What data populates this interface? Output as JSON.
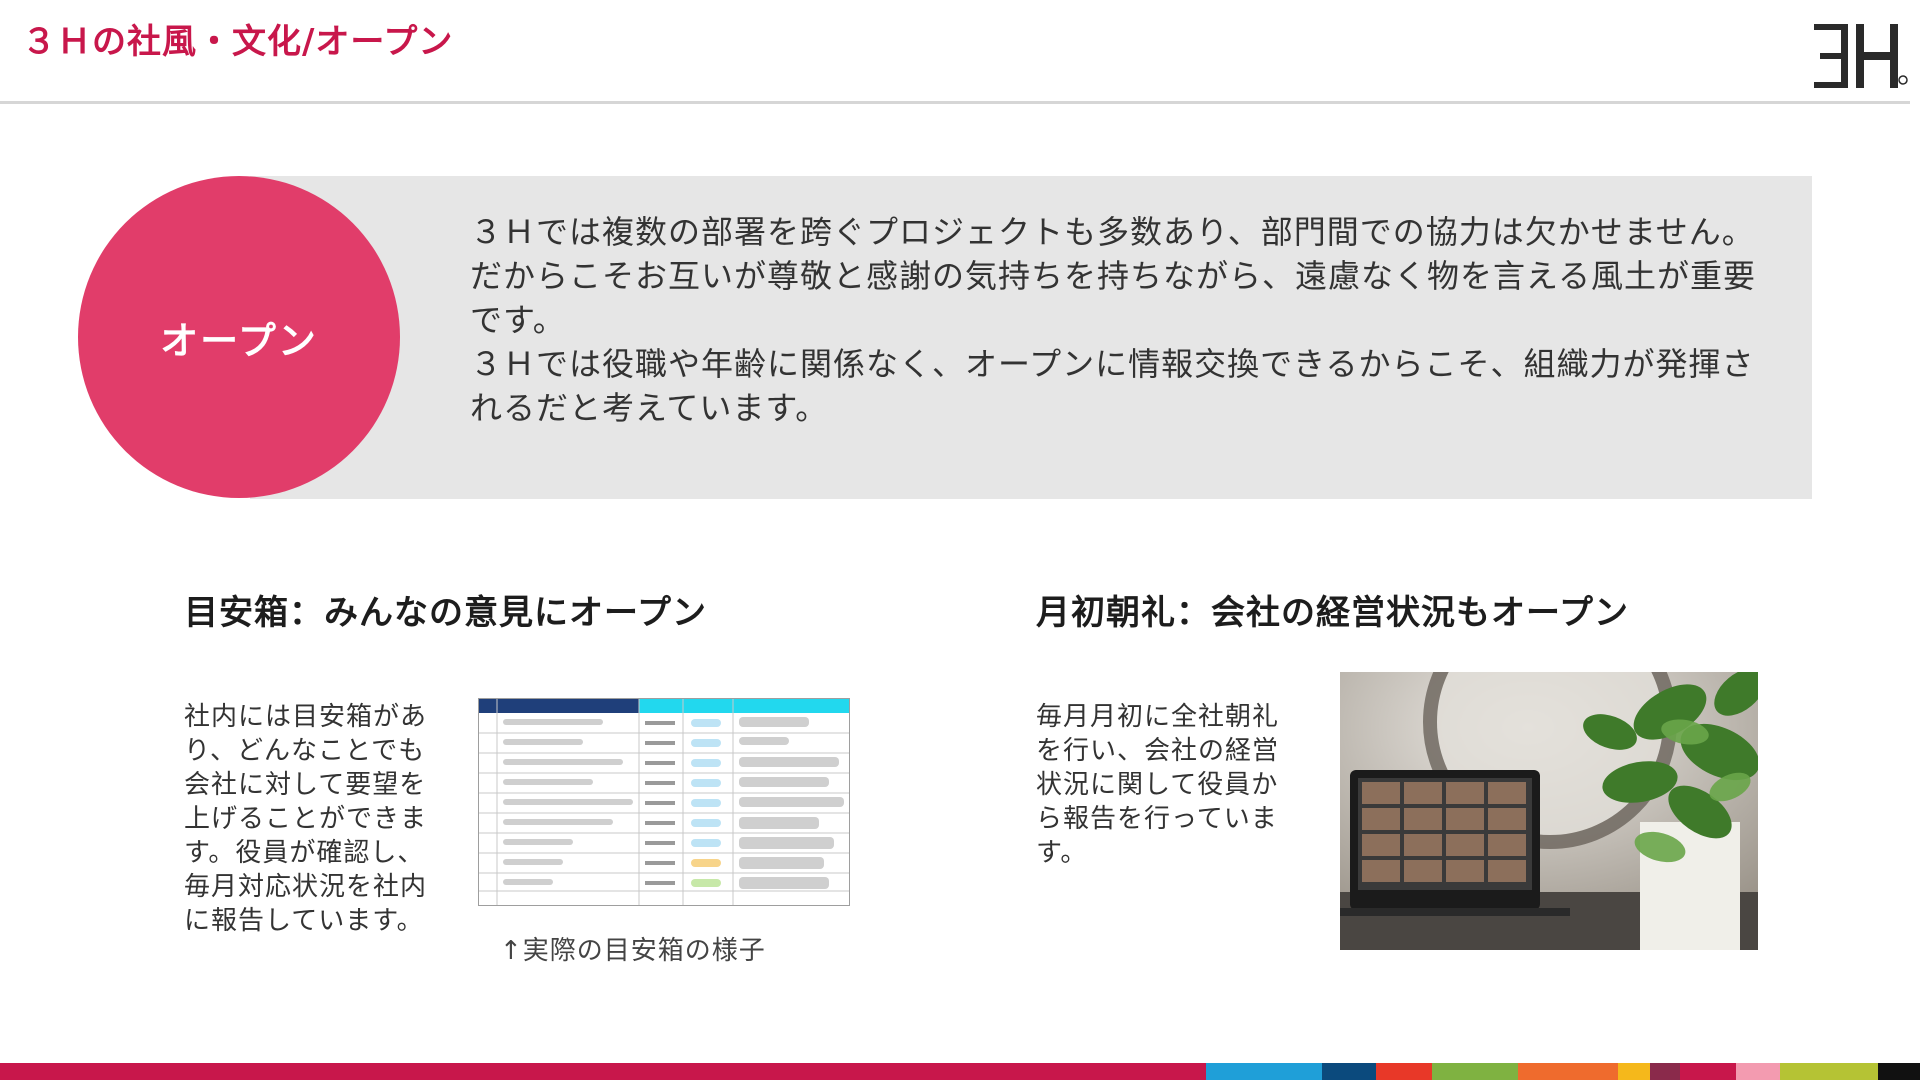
{
  "header": {
    "title": "３Ｈの社風・文化/オープン",
    "logo_text": "3H"
  },
  "open_section": {
    "circle_label": "オープン",
    "paragraphs": [
      "３Ｈでは複数の部署を跨ぐプロジェクトも多数あり、部門間での協力は欠かせません。だからこそお互いが尊敬と感謝の気持ちを持ちながら、遠慮なく物を言える風土が重要です。",
      "３Ｈでは役職や年齢に関係なく、オープンに情報交換できるからこそ、組織力が発揮されるだと考えています。"
    ]
  },
  "suggestion_box": {
    "heading": "目安箱：みんなの意見にオープン",
    "body": "社内には目安箱があり、どんなことでも会社に対して要望を上げることができます。役員が確認し、毎月対応状況を社内に報告しています。",
    "caption": "↑実際の目安箱の様子",
    "image_name": "suggestion-box-table-screenshot"
  },
  "monthly_meeting": {
    "heading": "月初朝礼：会社の経営状況もオープン",
    "body": "毎月月初に全社朝礼を行い、会社の経営状況に関して役員から報告を行っています。",
    "image_name": "video-meeting-laptop-photo"
  },
  "colors": {
    "accent": "#c8174b",
    "circle": "#e13d6a",
    "panel": "#e6e6e6",
    "footer": [
      "#c8174b",
      "#1f9fd8",
      "#0b4a7d",
      "#e83828",
      "#7fb241",
      "#ef6b2d",
      "#f5b81b",
      "#8a2a4b",
      "#c8174b",
      "#f39bb0",
      "#b5c334",
      "#111111"
    ]
  }
}
